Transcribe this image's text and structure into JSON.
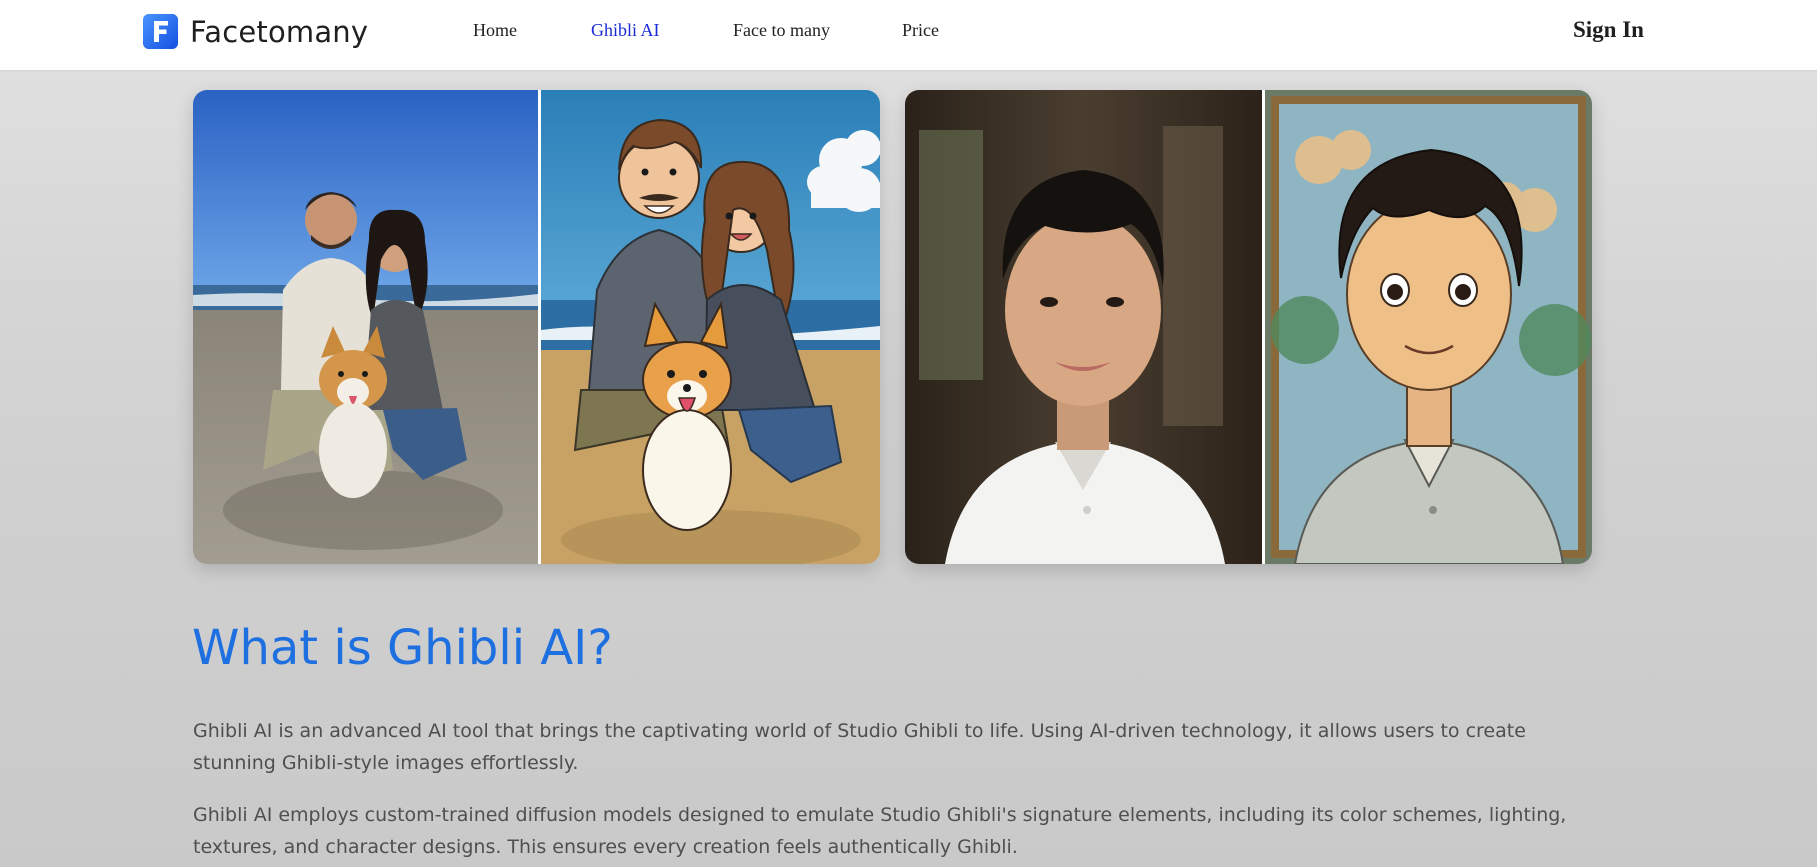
{
  "brand": {
    "name": "Facetomany",
    "logo_letter": "F",
    "accent": "#1a5cf2"
  },
  "nav": {
    "items": [
      {
        "label": "Home",
        "active": false
      },
      {
        "label": "Ghibli AI",
        "active": true
      },
      {
        "label": "Face to many",
        "active": false
      },
      {
        "label": "Price",
        "active": false
      }
    ],
    "active_color": "#1a2bd6",
    "signin_label": "Sign In"
  },
  "showcase": {
    "cards": [
      {
        "original": "beach-couple-corgi-photo",
        "result": "beach-couple-corgi-ghibli-style"
      },
      {
        "original": "young-man-portrait-photo",
        "result": "young-man-portrait-ghibli-style"
      }
    ]
  },
  "content": {
    "title": "What is Ghibli AI?",
    "title_color": "#1e6fe0",
    "paragraphs": [
      "Ghibli AI is an advanced AI tool that brings the captivating world of Studio Ghibli to life. Using AI-driven technology, it allows users to create stunning Ghibli-style images effortlessly.",
      "Ghibli AI employs custom-trained diffusion models designed to emulate Studio Ghibli's signature elements, including its color schemes, lighting, textures, and character designs. This ensures every creation feels authentically Ghibli."
    ]
  }
}
